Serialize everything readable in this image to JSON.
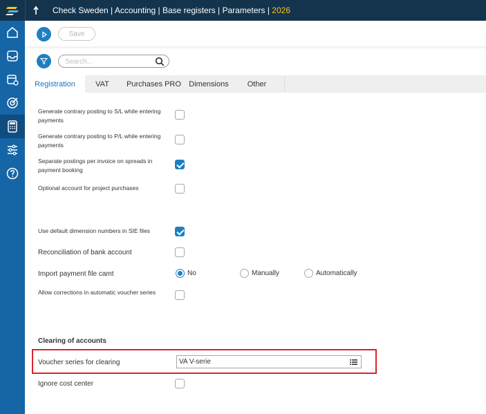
{
  "header": {
    "breadcrumb": "Check Sweden | Accounting | Base registers | Parameters |",
    "year": "2026"
  },
  "toolbar": {
    "save_label": "Save",
    "search_placeholder": "Search..."
  },
  "tabs": [
    {
      "label": "Registration",
      "active": true
    },
    {
      "label": "VAT",
      "active": false
    },
    {
      "label": "Purchases PRO",
      "active": false
    },
    {
      "label": "Dimensions",
      "active": false
    },
    {
      "label": "Other",
      "active": false
    }
  ],
  "settings": {
    "contrary_sl": {
      "label": "Generate contrary posting to S/L while entering payments",
      "checked": false
    },
    "contrary_pl": {
      "label": "Generate contrary posting to P/L while entering payments",
      "checked": false
    },
    "separate_postings": {
      "label": "Separate postings per invoice on spreads in payment booking",
      "checked": true
    },
    "optional_account": {
      "label": "Optional account for project purchases",
      "checked": false
    },
    "default_dims": {
      "label": "Use default dimension numbers in SIE files",
      "checked": true
    },
    "reconciliation": {
      "label": "Reconciliation of bank account",
      "checked": false
    },
    "import_payment": {
      "label": "Import payment file camt",
      "options": [
        {
          "label": "No",
          "selected": true
        },
        {
          "label": "Manually",
          "selected": false
        },
        {
          "label": "Automatically",
          "selected": false
        }
      ]
    },
    "allow_corrections": {
      "label": "Allow corrections in automatic voucher series",
      "checked": false
    }
  },
  "clearing": {
    "title": "Clearing of accounts",
    "voucher_label": "Voucher series for clearing",
    "voucher_value": "VA V-serie",
    "ignore_cost_center": {
      "label": "Ignore cost center",
      "checked": false
    }
  },
  "colors": {
    "topbar": "#14344d",
    "sidebar": "#1565a7",
    "accent": "#1e7fc2",
    "highlight": "#d9232a",
    "year": "#f5c518"
  }
}
